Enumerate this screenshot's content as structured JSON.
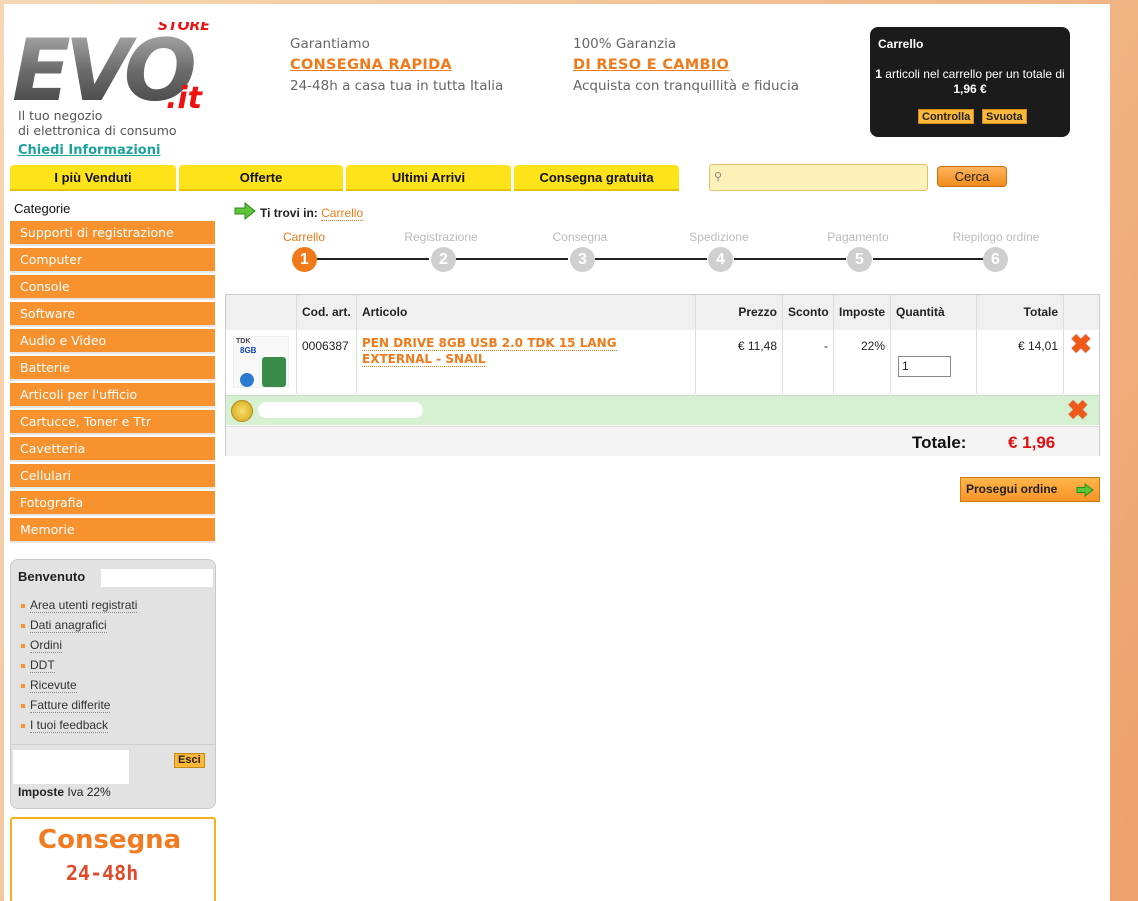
{
  "header": {
    "logo": {
      "main": "EVO",
      "suffix": ".it",
      "tag": "STORE"
    },
    "tagline_1": "Il tuo negozio",
    "tagline_2": "di elettronica di consumo",
    "chiedi": "Chiedi Informazioni",
    "promo1": {
      "small": "Garantiamo",
      "big": "CONSEGNA RAPIDA",
      "sub": "24-48h a casa tua in tutta Italia"
    },
    "promo2": {
      "small": "100% Garanzia",
      "big": "DI RESO E CAMBIO",
      "sub": "Acquista con tranquillità e fiducia"
    }
  },
  "cart_box": {
    "title": "Carrello",
    "count": "1",
    "info_mid": " articoli nel carrello per un totale di ",
    "total": "1,96 €",
    "controlla": "Controlla",
    "svuota": "Svuota"
  },
  "nav": [
    "I più Venduti",
    "Offerte",
    "Ultimi Arrivi",
    "Consegna gratuita"
  ],
  "search": {
    "button": "Cerca",
    "value": ""
  },
  "sidebar": {
    "title": "Categorie",
    "categories": [
      "Supporti di registrazione",
      "Computer",
      "Console",
      "Software",
      "Audio e Video",
      "Batterie",
      "Articoli per l'ufficio",
      "Cartucce, Toner e Ttr",
      "Cavetteria",
      "Cellulari",
      "Fotografia",
      "Memorie"
    ],
    "welcome": "Benvenuto",
    "links": [
      "Area utenti registrati",
      "Dati anagrafici",
      "Ordini",
      "DDT",
      "Ricevute",
      "Fatture differite",
      "I tuoi feedback"
    ],
    "esci": "Esci",
    "imposte_label": "Imposte",
    "imposte_value": "Iva 22%",
    "banner_1": "Consegna",
    "banner_2": "24-48h"
  },
  "breadcrumb": {
    "prefix": "Ti trovi in:",
    "current": "Carrello"
  },
  "steps": [
    {
      "label": "Carrello",
      "num": "1"
    },
    {
      "label": "Registrazione",
      "num": "2"
    },
    {
      "label": "Consegna",
      "num": "3"
    },
    {
      "label": "Spedizione",
      "num": "4"
    },
    {
      "label": "Pagamento",
      "num": "5"
    },
    {
      "label": "Riepilogo ordine",
      "num": "6"
    }
  ],
  "table": {
    "headers": {
      "cod": "Cod. art.",
      "articolo": "Articolo",
      "prezzo": "Prezzo",
      "sconto": "Sconto",
      "imposte": "Imposte",
      "quantita": "Quantità",
      "totale": "Totale"
    },
    "row": {
      "cod": "0006387",
      "articolo": "PEN DRIVE 8GB USB 2.0 TDK 15 LANG EXTERNAL - SNAIL",
      "prezzo": "€ 11,48",
      "sconto": "-",
      "imposte": "22%",
      "quantita": "1",
      "totale": "€ 14,01",
      "thumb_brand": "TDK",
      "thumb_size": "8GB"
    },
    "total_label": "Totale:",
    "total_value": "€ 1,96"
  },
  "prosegui": "Prosegui ordine",
  "colors": {
    "accent": "#f07a1a",
    "nav": "#ffe31a",
    "category": "#f7922f",
    "total": "#e01010"
  }
}
